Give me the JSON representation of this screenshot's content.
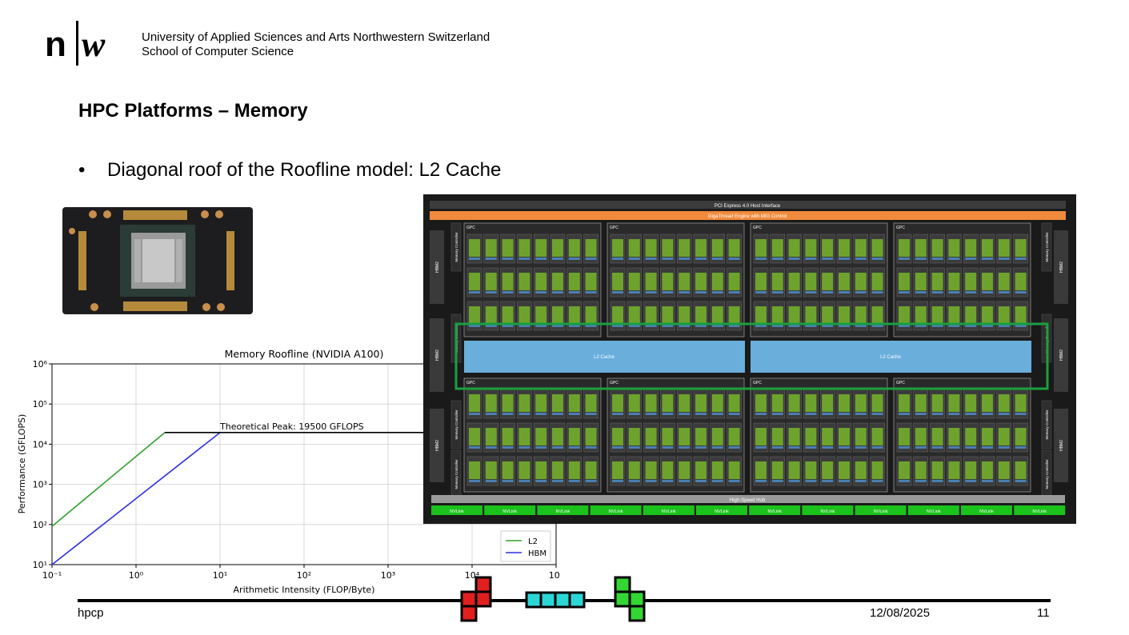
{
  "header": {
    "logo_text": "n|w",
    "institution_line1": "University of Applied Sciences and Arts Northwestern Switzerland",
    "institution_line2": "School of Computer Science"
  },
  "slide": {
    "title": "HPC Platforms – Memory",
    "bullet_marker": "•",
    "bullet_text": "Diagonal roof of the Roofline model: L2 Cache"
  },
  "footer": {
    "left": "hpcp",
    "date": "12/08/2025",
    "page": "11"
  },
  "diagram": {
    "pci_label": "PCI Express 4.0 Host Interface",
    "gigathread_label": "GigaThread Engine with MIG Control",
    "l2_left": "L2 Cache",
    "l2_right": "L2 Cache",
    "hub_label": "High-Speed Hub",
    "gpc_label": "GPC",
    "hbm_label": "HBM2",
    "memctrl_label": "Memory Controller",
    "nvlink_label": "NVLink",
    "nvlink_count": 12,
    "colors": {
      "pci": "#3c3c3c",
      "gigathread": "#f08a3c",
      "l2": "#6aaedc",
      "nvlink": "#1bc21b",
      "highlight": "#18a040",
      "sm": "#6da32c"
    }
  },
  "chart_data": {
    "type": "line",
    "title": "Memory Roofline (NVIDIA A100)",
    "xlabel": "Arithmetic Intensity (FLOP/Byte)",
    "ylabel": "Performance (GFLOPS)",
    "xscale": "log",
    "yscale": "log",
    "xlim": [
      0.1,
      100000
    ],
    "ylim": [
      10,
      1000000
    ],
    "xticks": [
      "10⁻¹",
      "10⁰",
      "10¹",
      "10²",
      "10³",
      "10⁴",
      "10⁵"
    ],
    "yticks": [
      "10¹",
      "10²",
      "10³",
      "10⁴",
      "10⁵",
      "10⁶"
    ],
    "grid": true,
    "legend_position": "bottom-right",
    "annotation": "Theoretical Peak: 19500 GFLOPS",
    "series": [
      {
        "name": "L2",
        "color": "#2ca02c",
        "x": [
          0.1,
          2.2,
          100000
        ],
        "y": [
          90,
          19500,
          19500
        ]
      },
      {
        "name": "HBM",
        "color": "#3030e0",
        "x": [
          0.1,
          10,
          100000
        ],
        "y": [
          10,
          19500,
          19500
        ]
      }
    ]
  }
}
